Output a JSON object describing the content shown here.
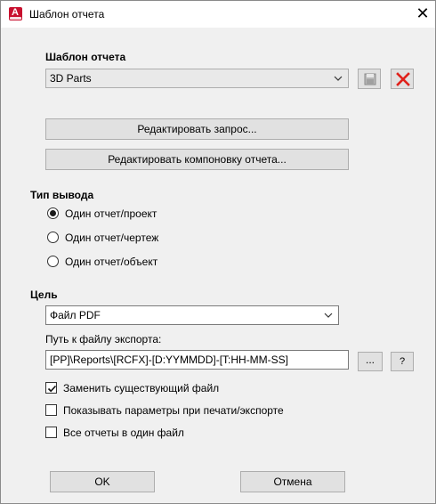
{
  "window": {
    "title": "Шаблон отчета",
    "close_glyph": "✕"
  },
  "template_section": {
    "heading": "Шаблон отчета",
    "selected": "3D Parts",
    "save_icon": "save-icon",
    "delete_icon": "delete-icon",
    "edit_query_label": "Редактировать запрос...",
    "edit_layout_label": "Редактировать компоновку отчета..."
  },
  "output_type": {
    "heading": "Тип вывода",
    "options": [
      {
        "label": "Один отчет/проект",
        "checked": true
      },
      {
        "label": "Один отчет/чертеж",
        "checked": false
      },
      {
        "label": "Один отчет/объект",
        "checked": false
      }
    ]
  },
  "target": {
    "heading": "Цель",
    "selected": "Файл PDF",
    "path_label": "Путь к файлу экспорта:",
    "path_value": "[PP]\\Reports\\[RCFX]-[D:YYMMDD]-[T:HH-MM-SS]",
    "browse_label": "...",
    "help_label": "?"
  },
  "checkboxes": [
    {
      "label": "Заменить существующий файл",
      "checked": true
    },
    {
      "label": "Показывать параметры при печати/экспорте",
      "checked": false
    },
    {
      "label": "Все отчеты в один файл",
      "checked": false
    }
  ],
  "footer": {
    "ok_label": "OK",
    "cancel_label": "Отмена"
  },
  "colors": {
    "accent_icon": "#c8102e",
    "delete_red": "#e0201a"
  }
}
